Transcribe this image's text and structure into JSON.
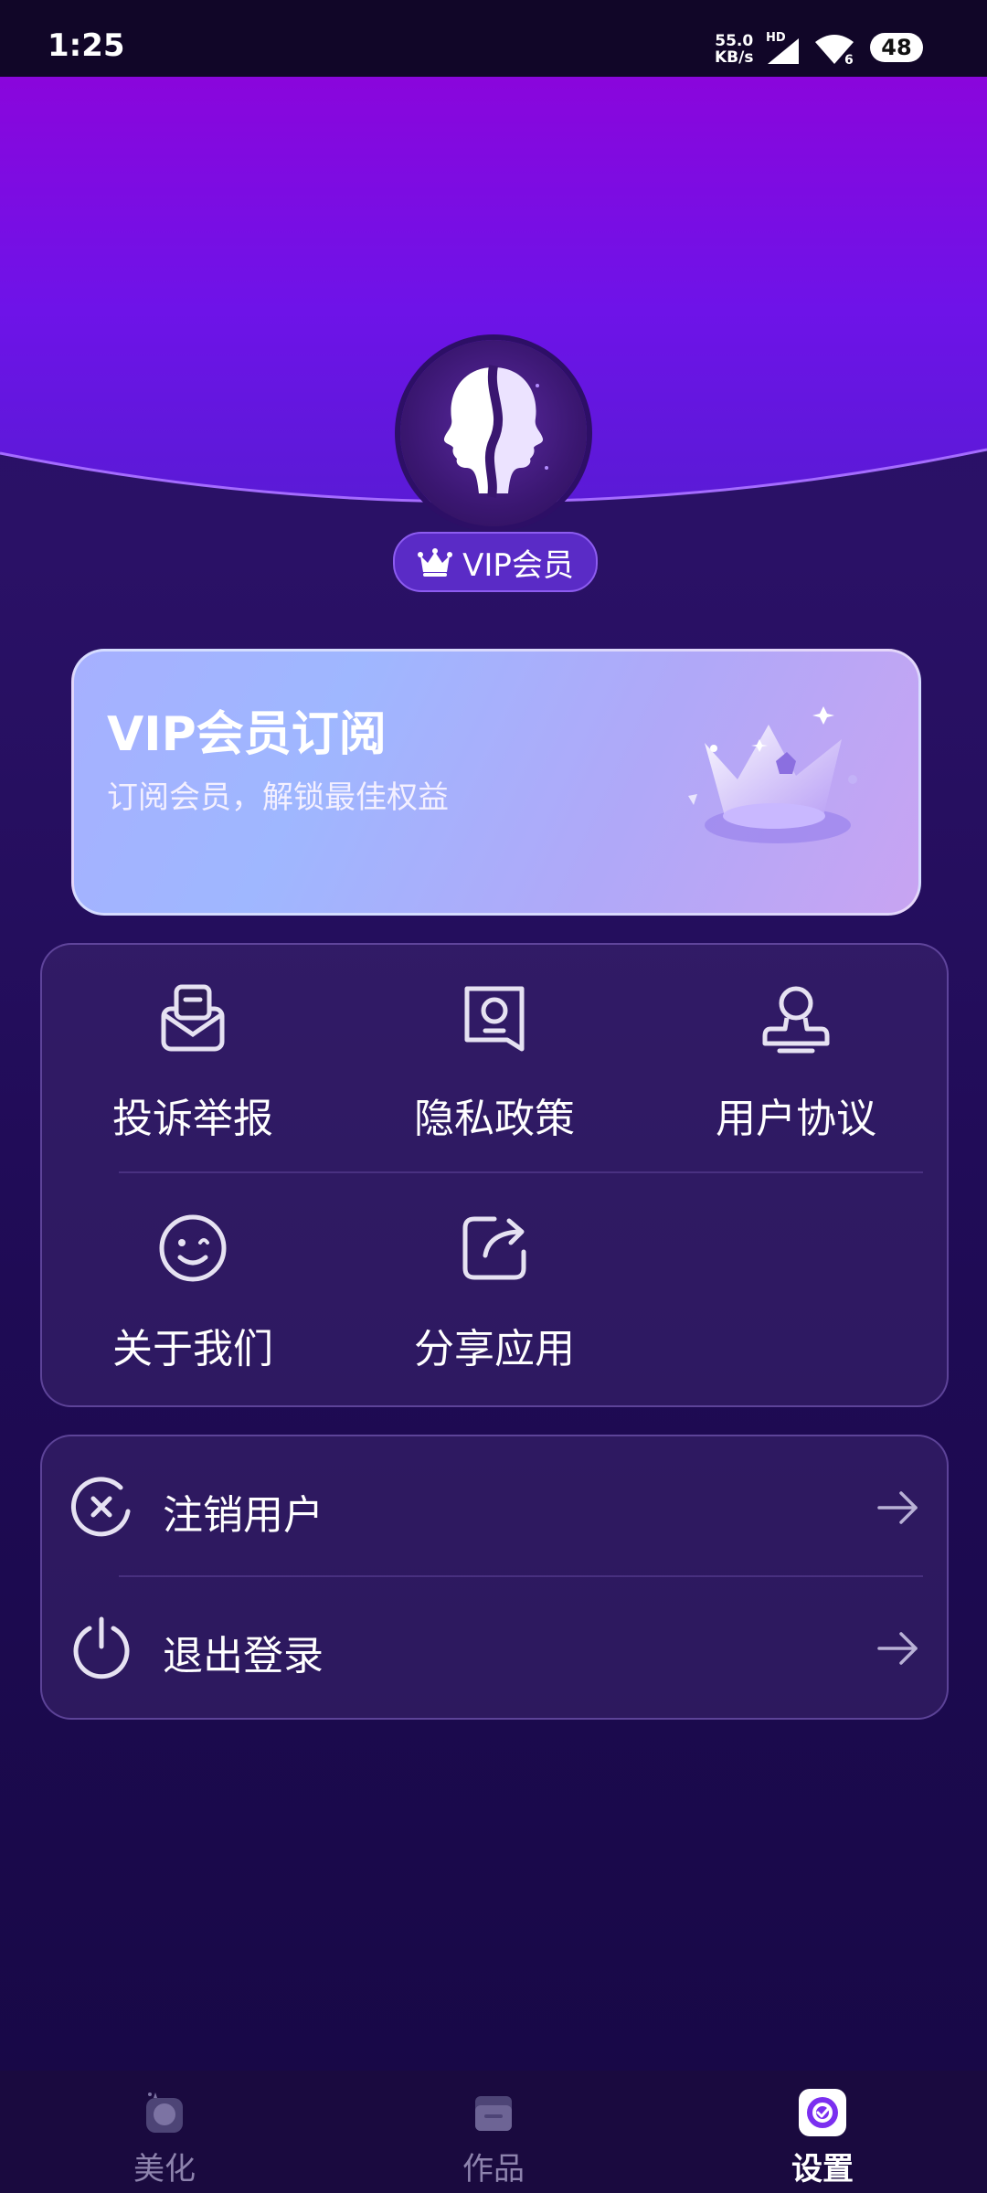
{
  "status_bar": {
    "time": "1:25",
    "speed_value": "55.0",
    "speed_unit": "KB/s",
    "hd": "HD",
    "wifi_badge": "6",
    "battery": "48"
  },
  "profile": {
    "membership_label": "VIP会员"
  },
  "vip_card": {
    "title": "VIP会员订阅",
    "subtitle": "订阅会员，解锁最佳权益"
  },
  "grid": {
    "items": [
      {
        "label": "投诉举报",
        "icon": "mail-report-icon"
      },
      {
        "label": "隐私政策",
        "icon": "privacy-doc-icon"
      },
      {
        "label": "用户协议",
        "icon": "user-agreement-icon"
      },
      {
        "label": "关于我们",
        "icon": "smile-icon"
      },
      {
        "label": "分享应用",
        "icon": "share-icon"
      }
    ]
  },
  "account": {
    "items": [
      {
        "label": "注销用户",
        "icon": "cancel-circle-icon"
      },
      {
        "label": "退出登录",
        "icon": "power-icon"
      }
    ]
  },
  "bottom_nav": {
    "items": [
      {
        "label": "美化",
        "icon": "beautify-icon",
        "active": false
      },
      {
        "label": "作品",
        "icon": "works-folder-icon",
        "active": false
      },
      {
        "label": "设置",
        "icon": "settings-icon",
        "active": true
      }
    ]
  },
  "colors": {
    "accent": "#7b2ff0",
    "header_top": "#8a0fe0",
    "background": "#1f0b55"
  }
}
